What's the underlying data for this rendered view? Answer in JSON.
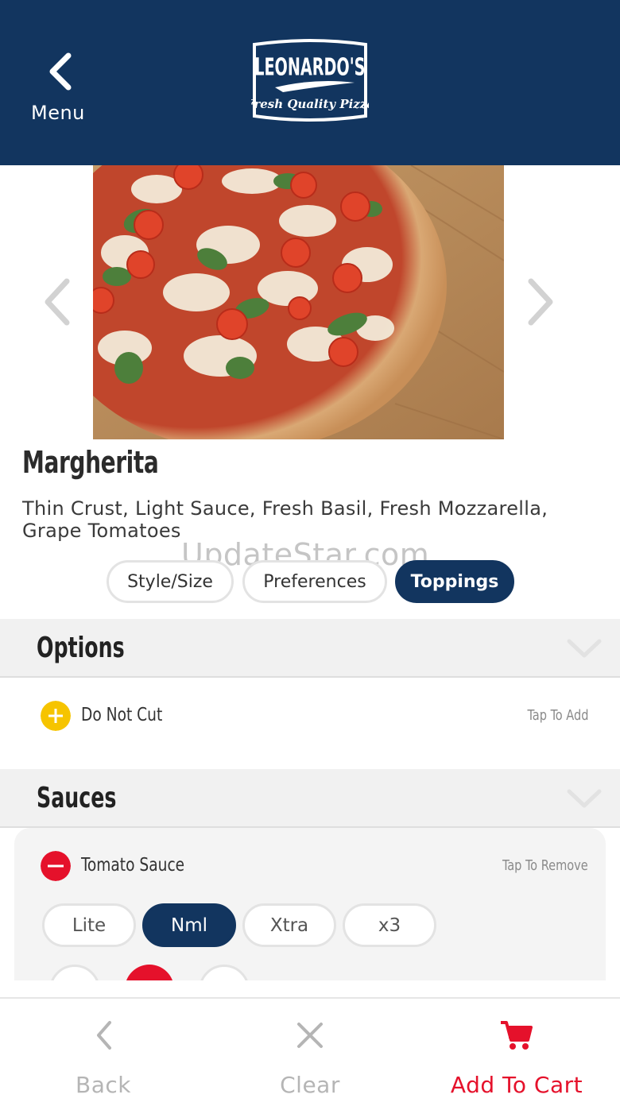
{
  "header": {
    "back_label": "Menu",
    "logo_name": "LEONARDO'S",
    "logo_tagline": "Fresh Quality Pizza",
    "background_color": "#12355f"
  },
  "product": {
    "name": "Margherita",
    "description": "Thin Crust, Light Sauce, Fresh Basil, Fresh Mozzarella, Grape Tomatoes"
  },
  "watermark": "UpdateStar.com",
  "tabs": [
    {
      "label": "Style/Size",
      "active": false
    },
    {
      "label": "Preferences",
      "active": false
    },
    {
      "label": "Toppings",
      "active": true
    }
  ],
  "sections": {
    "options": {
      "title": "Options",
      "items": [
        {
          "label": "Do Not Cut",
          "hint": "Tap To Add",
          "icon": "plus-circle-icon",
          "icon_color": "#f6c400"
        }
      ]
    },
    "sauces": {
      "title": "Sauces",
      "items": [
        {
          "label": "Tomato Sauce",
          "hint": "Tap To Remove",
          "icon": "minus-circle-icon",
          "icon_color": "#e5112b",
          "amounts": [
            {
              "label": "Lite",
              "selected": false
            },
            {
              "label": "Nml",
              "selected": true
            },
            {
              "label": "Xtra",
              "selected": false
            },
            {
              "label": "x3",
              "selected": false
            }
          ]
        }
      ]
    }
  },
  "bottom_bar": {
    "back_label": "Back",
    "clear_label": "Clear",
    "add_to_cart_label": "Add To Cart",
    "inactive_color": "#b5b5b5",
    "accent_color": "#e5112b"
  }
}
